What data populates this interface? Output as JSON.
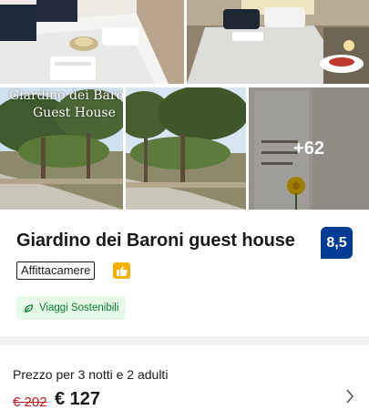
{
  "gallery": {
    "overlay_title_line1": "Giardino dei Baro",
    "overlay_title_line2": "Guest House",
    "more_photos": "+62"
  },
  "property": {
    "name": "Giardino dei Baroni guest house",
    "score": "8,5",
    "type": "Affittacamere",
    "sustainability_label": "Viaggi Sostenibili"
  },
  "price": {
    "label": "Prezzo per 3 notti e 2 adulti",
    "original": "€ 202",
    "current": "€ 127"
  },
  "colors": {
    "score_bg": "#003b95",
    "old_price": "#c4161c",
    "sustain_bg": "#e7fbe9",
    "sustain_text": "#0a7a2c",
    "thumb_badge": "#f5b100"
  }
}
